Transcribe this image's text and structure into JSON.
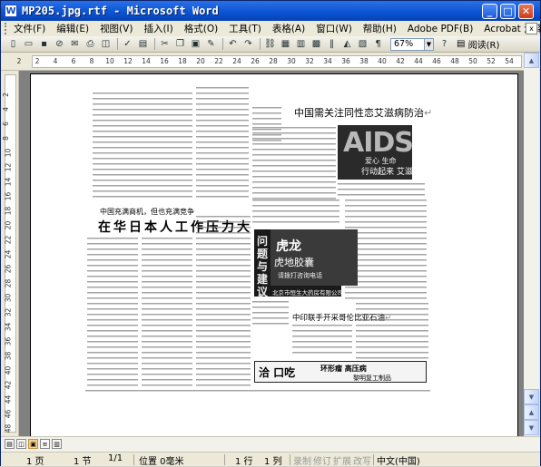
{
  "window": {
    "title": "MP205.jpg.rtf - Microsoft Word",
    "app_icon": "W",
    "minimize_icon": "_",
    "maximize_icon": "□",
    "close_icon": "✕"
  },
  "menu": {
    "items": [
      "文件(F)",
      "编辑(E)",
      "视图(V)",
      "插入(I)",
      "格式(O)",
      "工具(T)",
      "表格(A)",
      "窗口(W)",
      "帮助(H)",
      "Adobe PDF(B)",
      "Acrobat 注释(C)"
    ],
    "help_close": "x"
  },
  "toolbar": {
    "icons": [
      "new-document-icon",
      "open-icon",
      "save-icon",
      "permission-icon",
      "email-icon",
      "print-icon",
      "print-preview-icon",
      "spelling-icon",
      "research-icon",
      "cut-icon",
      "copy-icon",
      "paste-icon",
      "format-painter-icon",
      "undo-icon",
      "redo-icon",
      "hyperlink-icon",
      "tables-borders-icon",
      "insert-table-icon",
      "insert-excel-icon",
      "columns-icon",
      "drawing-icon",
      "document-map-icon",
      "show-hide-icon"
    ],
    "zoom_value": "67%",
    "read_label": "阅读(R)",
    "help_icon": "?"
  },
  "ruler": {
    "horizontal_ticks": [
      "2",
      "2",
      "4",
      "6",
      "8",
      "10",
      "12",
      "14",
      "16",
      "18",
      "20",
      "22",
      "24",
      "26",
      "28",
      "30",
      "32",
      "34",
      "36",
      "38",
      "40",
      "42",
      "44",
      "46",
      "48",
      "50",
      "52",
      "54"
    ],
    "vertical_ticks": [
      "2",
      "4",
      "6",
      "8",
      "10",
      "12",
      "14",
      "16",
      "18",
      "20",
      "22",
      "24",
      "26",
      "28",
      "30",
      "32",
      "34",
      "36",
      "38",
      "40",
      "42",
      "44",
      "46",
      "48"
    ]
  },
  "document": {
    "headline_right": "中国需关注同性恋艾滋病防治",
    "subheadline_left": "中国充满商机，但也充满竞争",
    "headline_left": "在华日本人工作压力大",
    "headline_right2": "中印联手开采哥伦比亚石油",
    "aids_image": {
      "big": "AIDS",
      "caption1": "爱心 生命",
      "caption2": "行动起来 艾滋"
    },
    "ad_box": {
      "vertical": "问题与建议",
      "title": "虎龙",
      "line2": "虎地胶囊",
      "line3": "请拨打咨询电话",
      "line4": "北京市恒生大药房有限公司"
    },
    "ad_bottom": {
      "left": "洽 口吃",
      "mid": "环形瘤 高压病",
      "right": "黎明复工制品"
    },
    "paragraph_mark": "↵"
  },
  "status": {
    "page": "1 页",
    "section": "1 节",
    "pages": "1/1",
    "position": "位置 0毫米",
    "line": "1 行",
    "column": "1 列",
    "rec": "录制",
    "trk": "修订",
    "ext": "扩展",
    "ovr": "改写",
    "language": "中文(中国)"
  },
  "colors": {
    "titlebar": "#0a52d2",
    "chrome": "#ece9d8",
    "doc_background": "#808080"
  }
}
